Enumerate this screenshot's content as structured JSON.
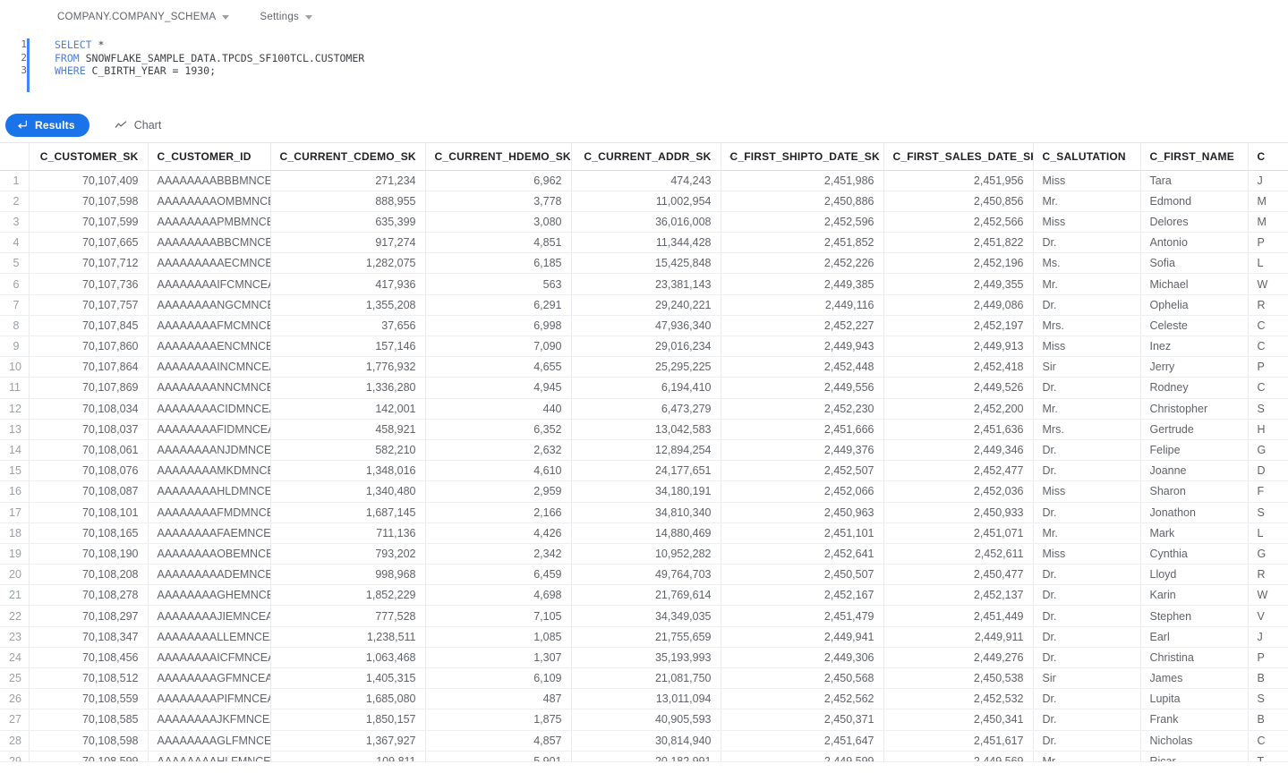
{
  "toolbar": {
    "schema_selector": "COMPANY.COMPANY_SCHEMA",
    "settings_label": "Settings"
  },
  "editor": {
    "line_numbers": [
      "1",
      "2",
      "3"
    ],
    "lines": [
      {
        "keyword": "SELECT",
        "rest": " *"
      },
      {
        "keyword": "FROM",
        "rest": " SNOWFLAKE_SAMPLE_DATA.TPCDS_SF100TCL.CUSTOMER"
      },
      {
        "keyword": "WHERE",
        "rest": " C_BIRTH_YEAR = 1930;"
      }
    ],
    "full_query": "SELECT *\nFROM SNOWFLAKE_SAMPLE_DATA.TPCDS_SF100TCL.CUSTOMER\nWHERE C_BIRTH_YEAR = 1930;"
  },
  "tabs": {
    "results_label": "Results",
    "chart_label": "Chart",
    "active": "Results",
    "accent_color": "#1a73e8"
  },
  "table": {
    "columns": [
      {
        "key": "rownum",
        "label": "",
        "align": "right",
        "icon": null
      },
      {
        "key": "c_customer_sk",
        "label": "C_CUSTOMER_SK",
        "align": "right",
        "icon": null
      },
      {
        "key": "c_customer_id",
        "label": "C_CUSTOMER_ID",
        "align": "left",
        "icon": null
      },
      {
        "key": "c_current_cdemo_sk",
        "label": "C_CURRENT_CDEMO_SK",
        "align": "right",
        "icon": null
      },
      {
        "key": "c_current_hdemo_sk",
        "label": "C_CURRENT_HDEMO_SK",
        "align": "right",
        "icon": null
      },
      {
        "key": "c_current_addr_sk",
        "label": "C_CURRENT_ADDR_SK",
        "align": "right",
        "icon": null
      },
      {
        "key": "c_first_shipto_date_sk",
        "label": "C_FIRST_SHIPTO_DATE_SK",
        "align": "right",
        "icon": "ellipsis-icon"
      },
      {
        "key": "c_first_sales_date_sk",
        "label": "C_FIRST_SALES_DATE_SK",
        "align": "right",
        "icon": null
      },
      {
        "key": "c_salutation",
        "label": "C_SALUTATION",
        "align": "left",
        "icon": null
      },
      {
        "key": "c_first_name",
        "label": "C_FIRST_NAME",
        "align": "left",
        "icon": null
      },
      {
        "key": "c_last_name",
        "label": "C",
        "align": "left",
        "icon": null
      }
    ],
    "rows": [
      [
        "1",
        "70,107,409",
        "AAAAAAAABBBMNCEA",
        "271,234",
        "6,962",
        "474,243",
        "2,451,986",
        "2,451,956",
        "Miss",
        "Tara",
        "J"
      ],
      [
        "2",
        "70,107,598",
        "AAAAAAAAOMBMNCEA",
        "888,955",
        "3,778",
        "11,002,954",
        "2,450,886",
        "2,450,856",
        "Mr.",
        "Edmond",
        "M"
      ],
      [
        "3",
        "70,107,599",
        "AAAAAAAAPMBMNCEA",
        "635,399",
        "3,080",
        "36,016,008",
        "2,452,596",
        "2,452,566",
        "Miss",
        "Delores",
        "M"
      ],
      [
        "4",
        "70,107,665",
        "AAAAAAAABBCMNCEA",
        "917,274",
        "4,851",
        "11,344,428",
        "2,451,852",
        "2,451,822",
        "Dr.",
        "Antonio",
        "P"
      ],
      [
        "5",
        "70,107,712",
        "AAAAAAAAAECMNCEA",
        "1,282,075",
        "6,185",
        "15,425,848",
        "2,452,226",
        "2,452,196",
        "Ms.",
        "Sofia",
        "L"
      ],
      [
        "6",
        "70,107,736",
        "AAAAAAAAIFCMNCEA",
        "417,936",
        "563",
        "23,381,143",
        "2,449,385",
        "2,449,355",
        "Mr.",
        "Michael",
        "W"
      ],
      [
        "7",
        "70,107,757",
        "AAAAAAAANGCMNCEA",
        "1,355,208",
        "6,291",
        "29,240,221",
        "2,449,116",
        "2,449,086",
        "Dr.",
        "Ophelia",
        "R"
      ],
      [
        "8",
        "70,107,845",
        "AAAAAAAAFMCMNCEA",
        "37,656",
        "6,998",
        "47,936,340",
        "2,452,227",
        "2,452,197",
        "Mrs.",
        "Celeste",
        "C"
      ],
      [
        "9",
        "70,107,860",
        "AAAAAAAAENCMNCEA",
        "157,146",
        "7,090",
        "29,016,234",
        "2,449,943",
        "2,449,913",
        "Miss",
        "Inez",
        "C"
      ],
      [
        "10",
        "70,107,864",
        "AAAAAAAAINCMNCEA",
        "1,776,932",
        "4,655",
        "25,295,225",
        "2,452,448",
        "2,452,418",
        "Sir",
        "Jerry",
        "P"
      ],
      [
        "11",
        "70,107,869",
        "AAAAAAAANNCMNCEA",
        "1,336,280",
        "4,945",
        "6,194,410",
        "2,449,556",
        "2,449,526",
        "Dr.",
        "Rodney",
        "C"
      ],
      [
        "12",
        "70,108,034",
        "AAAAAAAACIDMNCEA",
        "142,001",
        "440",
        "6,473,279",
        "2,452,230",
        "2,452,200",
        "Mr.",
        "Christopher",
        "S"
      ],
      [
        "13",
        "70,108,037",
        "AAAAAAAAFIDMNCEA",
        "458,921",
        "6,352",
        "13,042,583",
        "2,451,666",
        "2,451,636",
        "Mrs.",
        "Gertrude",
        "H"
      ],
      [
        "14",
        "70,108,061",
        "AAAAAAAANJDMNCEA",
        "582,210",
        "2,632",
        "12,894,254",
        "2,449,376",
        "2,449,346",
        "Dr.",
        "Felipe",
        "G"
      ],
      [
        "15",
        "70,108,076",
        "AAAAAAAAMKDMNCEA",
        "1,348,016",
        "4,610",
        "24,177,651",
        "2,452,507",
        "2,452,477",
        "Dr.",
        "Joanne",
        "D"
      ],
      [
        "16",
        "70,108,087",
        "AAAAAAAAHLDMNCEA",
        "1,340,480",
        "2,959",
        "34,180,191",
        "2,452,066",
        "2,452,036",
        "Miss",
        "Sharon",
        "F"
      ],
      [
        "17",
        "70,108,101",
        "AAAAAAAAFMDMNCEA",
        "1,687,145",
        "2,166",
        "34,810,340",
        "2,450,963",
        "2,450,933",
        "Dr.",
        "Jonathon",
        "S"
      ],
      [
        "18",
        "70,108,165",
        "AAAAAAAAFAEMNCEA",
        "711,136",
        "4,426",
        "14,880,469",
        "2,451,101",
        "2,451,071",
        "Mr.",
        "Mark",
        "L"
      ],
      [
        "19",
        "70,108,190",
        "AAAAAAAAOBEMNCEA",
        "793,202",
        "2,342",
        "10,952,282",
        "2,452,641",
        "2,452,611",
        "Miss",
        "Cynthia",
        "G"
      ],
      [
        "20",
        "70,108,208",
        "AAAAAAAAADEMNCEA",
        "998,968",
        "6,459",
        "49,764,703",
        "2,450,507",
        "2,450,477",
        "Dr.",
        "Lloyd",
        "R"
      ],
      [
        "21",
        "70,108,278",
        "AAAAAAAAGHEMNCEA",
        "1,852,229",
        "4,698",
        "21,769,614",
        "2,452,167",
        "2,452,137",
        "Dr.",
        "Karin",
        "W"
      ],
      [
        "22",
        "70,108,297",
        "AAAAAAAAJIEMNCEA",
        "777,528",
        "7,105",
        "34,349,035",
        "2,451,479",
        "2,451,449",
        "Dr.",
        "Stephen",
        "V"
      ],
      [
        "23",
        "70,108,347",
        "AAAAAAAALLEMNCEA",
        "1,238,511",
        "1,085",
        "21,755,659",
        "2,449,941",
        "2,449,911",
        "Dr.",
        "Earl",
        "J"
      ],
      [
        "24",
        "70,108,456",
        "AAAAAAAAICFMNCEA",
        "1,063,468",
        "1,307",
        "35,193,993",
        "2,449,306",
        "2,449,276",
        "Dr.",
        "Christina",
        "P"
      ],
      [
        "25",
        "70,108,512",
        "AAAAAAAAGFMNCEA",
        "1,405,315",
        "6,109",
        "21,081,750",
        "2,450,568",
        "2,450,538",
        "Sir",
        "James",
        "B"
      ],
      [
        "26",
        "70,108,559",
        "AAAAAAAAPIFMNCEA",
        "1,685,080",
        "487",
        "13,011,094",
        "2,452,562",
        "2,452,532",
        "Dr.",
        "Lupita",
        "S"
      ],
      [
        "27",
        "70,108,585",
        "AAAAAAAAJKFMNCEA",
        "1,850,157",
        "1,875",
        "40,905,593",
        "2,450,371",
        "2,450,341",
        "Dr.",
        "Frank",
        "B"
      ],
      [
        "28",
        "70,108,598",
        "AAAAAAAAGLFMNCEA",
        "1,367,927",
        "4,857",
        "30,814,940",
        "2,451,647",
        "2,451,617",
        "Dr.",
        "Nicholas",
        "C"
      ],
      [
        "29",
        "70,108,599",
        "AAAAAAAAHLFMNCEA",
        "109,811",
        "5,901",
        "20,182,991",
        "2,449,599",
        "2,449,569",
        "Mr.",
        "Ricar",
        "T"
      ]
    ]
  }
}
